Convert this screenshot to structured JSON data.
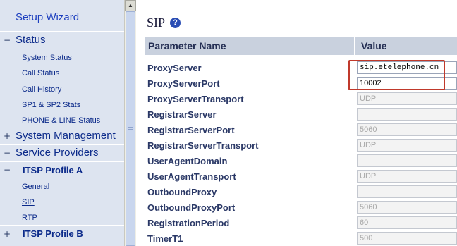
{
  "sidebar": {
    "wizard": "Setup Wizard",
    "status": {
      "label": "Status",
      "toggle": "−"
    },
    "status_links": [
      "System Status",
      "Call Status",
      "Call History",
      "SP1 & SP2 Stats",
      "PHONE & LINE Status"
    ],
    "system_management": {
      "label": "System Management",
      "toggle": "+"
    },
    "service_providers": {
      "label": "Service Providers",
      "toggle": "−"
    },
    "itsp_a": {
      "label": "ITSP Profile A",
      "toggle": "−"
    },
    "itsp_a_links": [
      "General",
      "SIP",
      "RTP"
    ],
    "active_link": "SIP",
    "itsp_b": {
      "label": "ITSP Profile B",
      "toggle": "+"
    }
  },
  "main": {
    "title": "SIP",
    "help_glyph": "?",
    "table": {
      "header_name": "Parameter Name",
      "header_value": "Value",
      "rows": [
        {
          "name": "ProxyServer",
          "value": "sip.etelephone.cn",
          "disabled": false
        },
        {
          "name": "ProxyServerPort",
          "value": "10002",
          "disabled": false
        },
        {
          "name": "ProxyServerTransport",
          "value": "UDP",
          "disabled": true
        },
        {
          "name": "RegistrarServer",
          "value": "",
          "disabled": true
        },
        {
          "name": "RegistrarServerPort",
          "value": "5060",
          "disabled": true
        },
        {
          "name": "RegistrarServerTransport",
          "value": "UDP",
          "disabled": true
        },
        {
          "name": "UserAgentDomain",
          "value": "",
          "disabled": true
        },
        {
          "name": "UserAgentTransport",
          "value": "UDP",
          "disabled": true
        },
        {
          "name": "OutboundProxy",
          "value": "",
          "disabled": true
        },
        {
          "name": "OutboundProxyPort",
          "value": "5060",
          "disabled": true
        },
        {
          "name": "RegistrationPeriod",
          "value": "60",
          "disabled": true
        },
        {
          "name": "TimerT1",
          "value": "500",
          "disabled": true
        }
      ]
    }
  },
  "colors": {
    "sidebar_bg": "#dde4f0",
    "nav_text": "#0b2a8a",
    "header_bg": "#c9d1de",
    "highlight": "#c0392b"
  }
}
